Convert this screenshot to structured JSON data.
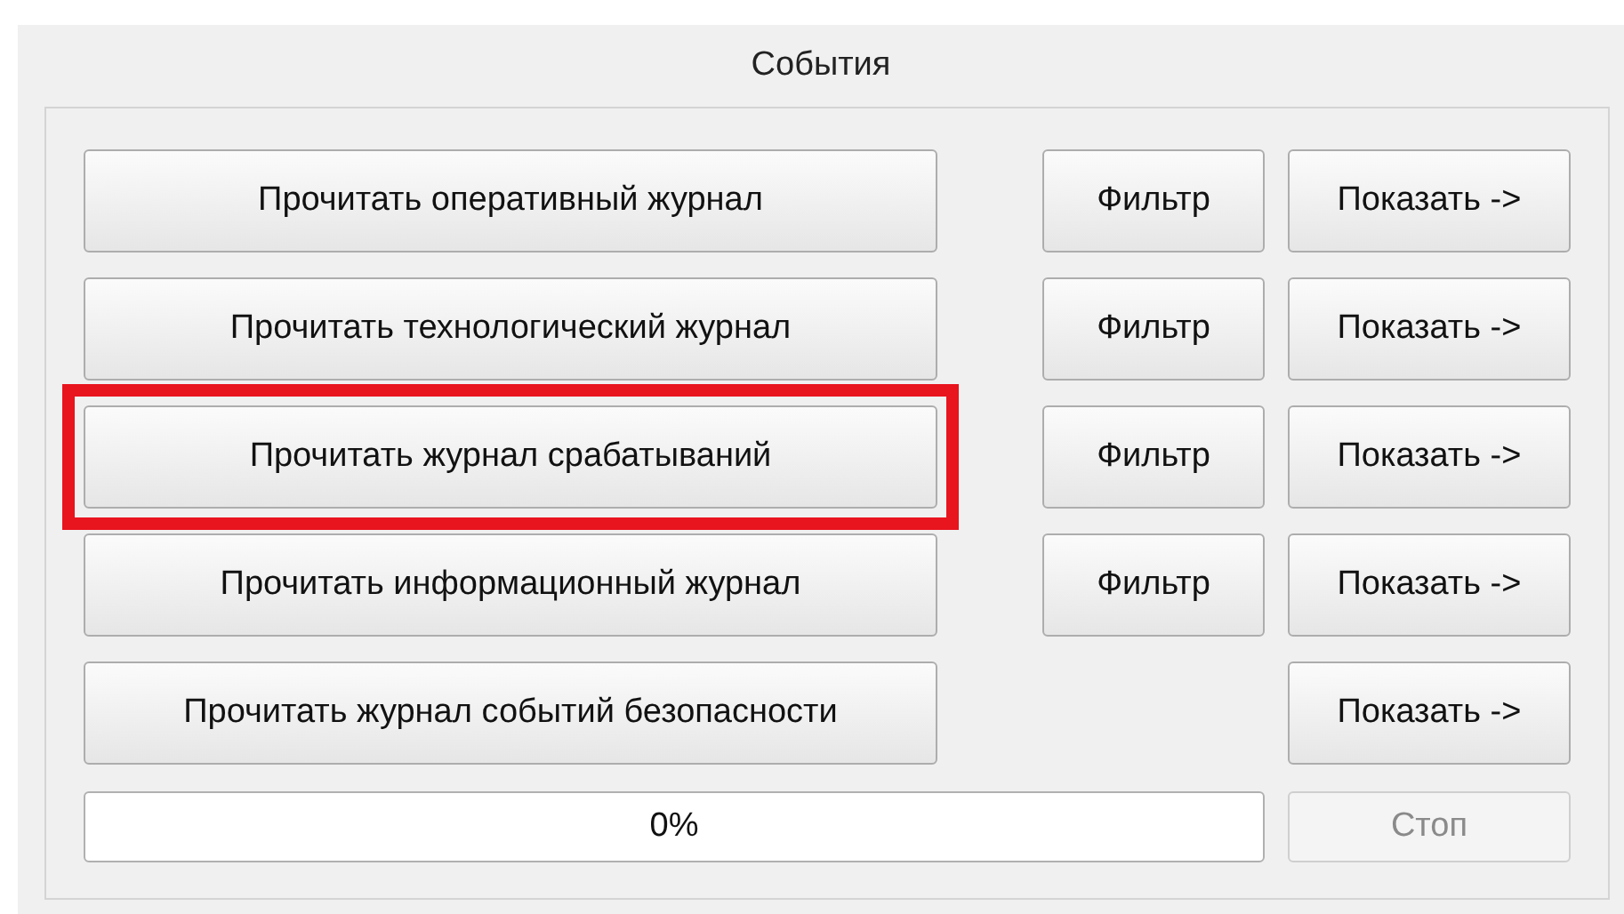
{
  "group": {
    "title": "События"
  },
  "rows": [
    {
      "read": "Прочитать оперативный журнал",
      "filter": "Фильтр",
      "show": "Показать ->",
      "highlighted": false
    },
    {
      "read": "Прочитать технологический журнал",
      "filter": "Фильтр",
      "show": "Показать ->",
      "highlighted": false
    },
    {
      "read": "Прочитать журнал срабатываний",
      "filter": "Фильтр",
      "show": "Показать ->",
      "highlighted": true
    },
    {
      "read": "Прочитать информационный журнал",
      "filter": "Фильтр",
      "show": "Показать ->",
      "highlighted": false
    },
    {
      "read": "Прочитать журнал событий безопасности",
      "show": "Показать ->",
      "highlighted": false
    }
  ],
  "progress": {
    "text": "0%",
    "level": 0
  },
  "stop": {
    "label": "Стоп",
    "disabled": true
  }
}
